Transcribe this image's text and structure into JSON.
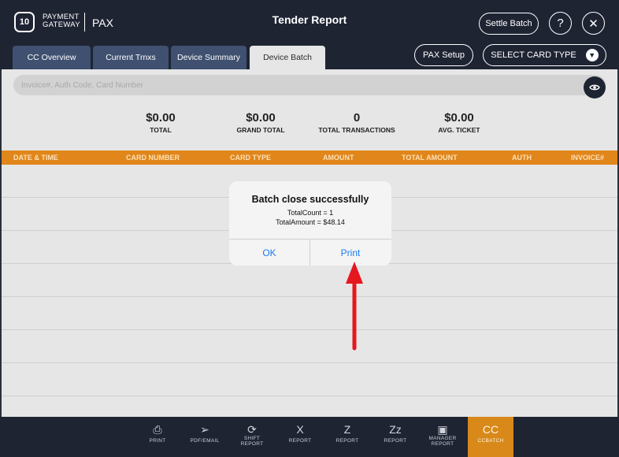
{
  "header": {
    "logo_day": "10",
    "logo_line1": "PAYMENT",
    "logo_line2": "GATEWAY",
    "logo_brand": "PAX",
    "title": "Tender Report",
    "settle_label": "Settle Batch",
    "help_label": "?",
    "close_label": "✕"
  },
  "tabs": [
    {
      "label": "CC Overview",
      "active": false
    },
    {
      "label": "Current Trnxs",
      "active": false
    },
    {
      "label": "Device Summary",
      "active": false
    },
    {
      "label": "Device Batch",
      "active": true
    }
  ],
  "pax_setup_label": "PAX Setup",
  "card_type_select": {
    "value": "SELECT CARD TYPE"
  },
  "search": {
    "placeholder": "Invoice#, Auth Code, Card Number"
  },
  "stats": [
    {
      "value": "$0.00",
      "label": "TOTAL"
    },
    {
      "value": "$0.00",
      "label": "GRAND TOTAL"
    },
    {
      "value": "0",
      "label": "TOTAL TRANSACTIONS"
    },
    {
      "value": "$0.00",
      "label": "AVG. TICKET"
    }
  ],
  "table": {
    "columns": [
      "DATE & TIME",
      "CARD NUMBER",
      "CARD TYPE",
      "AMOUNT",
      "TOTAL AMOUNT",
      "AUTH",
      "INVOICE#"
    ],
    "rows": []
  },
  "modal": {
    "title": "Batch close successfully",
    "line1": "TotalCount = 1",
    "line2": "TotalAmount = $48.14",
    "ok_label": "OK",
    "print_label": "Print"
  },
  "bottom_bar": [
    {
      "icon": "printer-icon",
      "glyph": "⎙",
      "label": "PRINT"
    },
    {
      "icon": "send-icon",
      "glyph": "➢",
      "label": "PDF/EMAIL"
    },
    {
      "icon": "refresh-icon",
      "glyph": "⟳",
      "label": "SHIFT REPORT"
    },
    {
      "icon": "x-report-icon",
      "glyph": "X",
      "label": "REPORT"
    },
    {
      "icon": "z-report-icon",
      "glyph": "Z",
      "label": "REPORT"
    },
    {
      "icon": "zz-report-icon",
      "glyph": "Zz",
      "label": "REPORT"
    },
    {
      "icon": "briefcase-icon",
      "glyph": "▣",
      "label": "MANAGER REPORT"
    },
    {
      "icon": "cc-icon",
      "glyph": "CC",
      "label": "CCBATCH",
      "active": true
    }
  ],
  "colors": {
    "header_bg": "#1f2433",
    "tab_bg": "#3f5070",
    "accent_orange": "#e0861a",
    "link_blue": "#1a7cf5",
    "arrow_red": "#e5171f"
  }
}
